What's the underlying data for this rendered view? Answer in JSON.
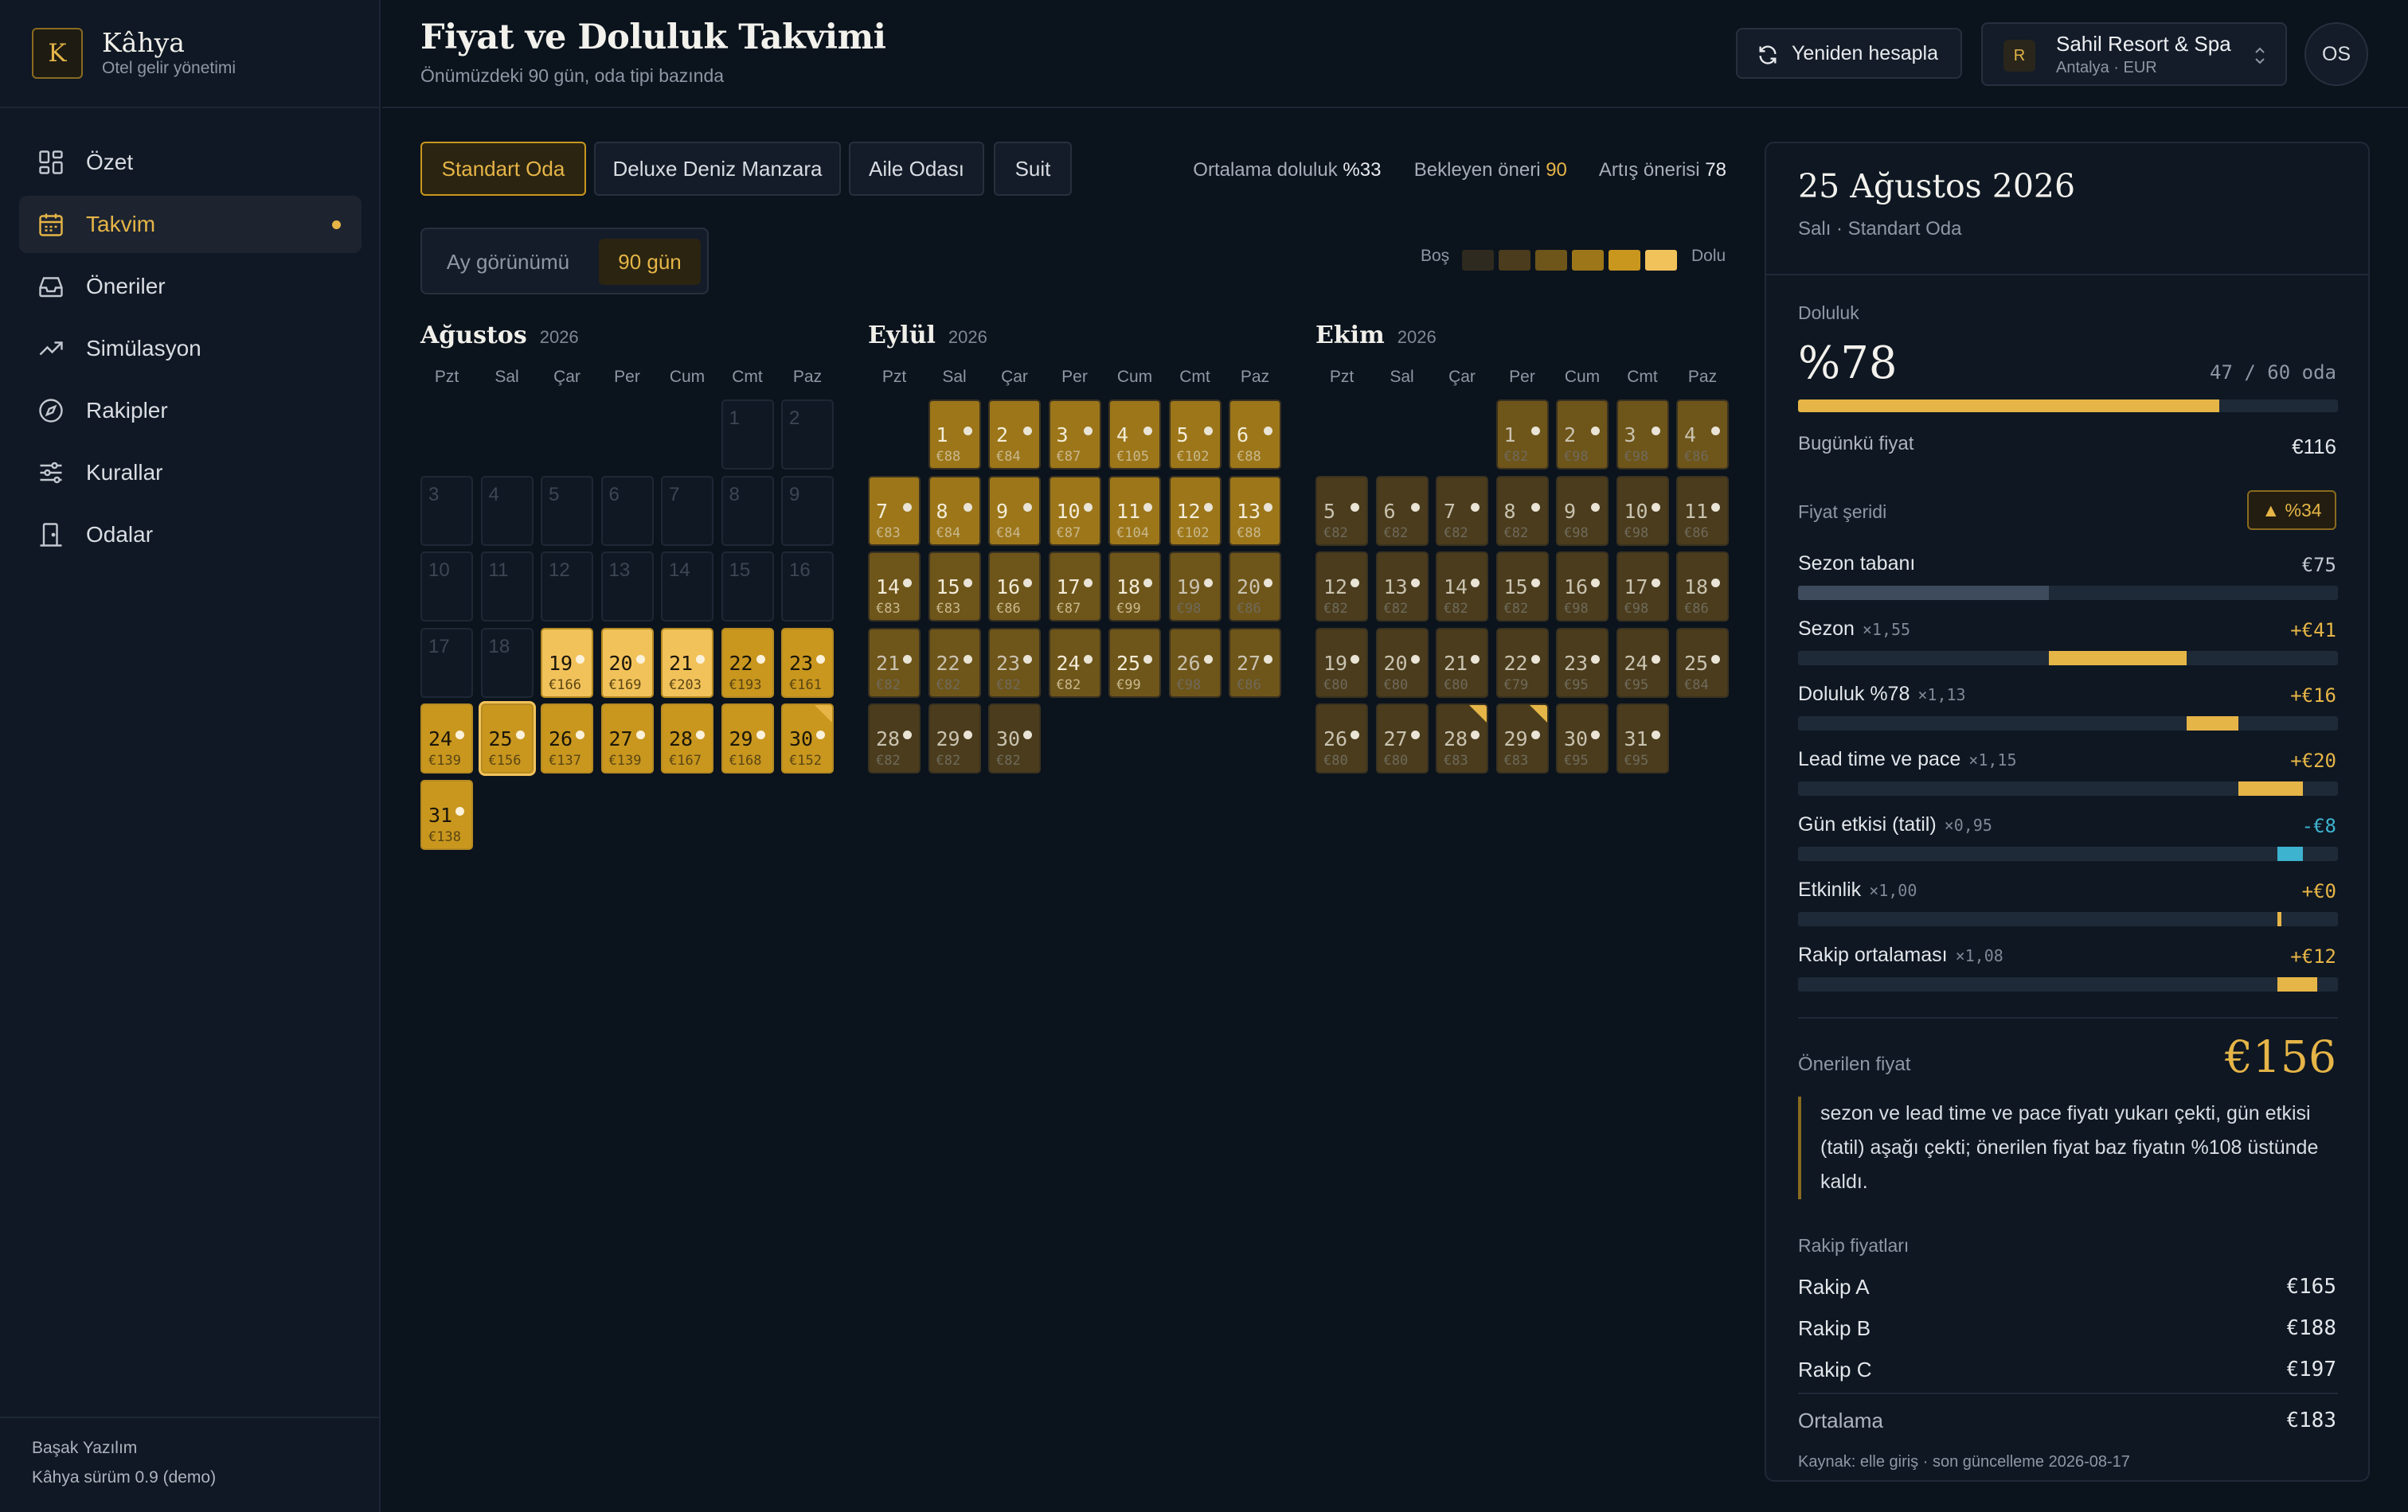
{
  "app": {
    "logo_letter": "K",
    "name": "Kâhya",
    "subtitle": "Otel gelir yönetimi"
  },
  "nav": [
    {
      "label": "Özet",
      "icon": "dashboard-icon"
    },
    {
      "label": "Takvim",
      "icon": "calendar-icon",
      "active": true
    },
    {
      "label": "Öneriler",
      "icon": "inbox-icon"
    },
    {
      "label": "Simülasyon",
      "icon": "trend-icon"
    },
    {
      "label": "Rakipler",
      "icon": "compass-icon"
    },
    {
      "label": "Kurallar",
      "icon": "sliders-icon"
    },
    {
      "label": "Odalar",
      "icon": "door-icon"
    }
  ],
  "footer": {
    "company": "Başak Yazılım",
    "version": "Kâhya sürüm 0.9 (demo)"
  },
  "header": {
    "title": "Fiyat ve Doluluk Takvimi",
    "subtitle": "Önümüzdeki 90 gün, oda tipi bazında",
    "recalc_label": "Yeniden hesapla",
    "hotel_badge": "R",
    "hotel_name": "Sahil Resort & Spa",
    "hotel_location": "Antalya · EUR",
    "avatar": "OS"
  },
  "room_tabs": [
    "Standart Oda",
    "Deluxe Deniz Manzara",
    "Aile Odası",
    "Suit"
  ],
  "stats": {
    "avg_label": "Ortalama doluluk",
    "avg_value": "%33",
    "pending_label": "Bekleyen öneri",
    "pending_value": "90",
    "raise_label": "Artış önerisi",
    "raise_value": "78"
  },
  "view_toggle": {
    "month": "Ay görünümü",
    "days90": "90 gün"
  },
  "legend": {
    "empty": "Boş",
    "full": "Dolu"
  },
  "weekdays": [
    "Pzt",
    "Sal",
    "Çar",
    "Per",
    "Cum",
    "Cmt",
    "Paz"
  ],
  "colors": {
    "accent": "#e6b547",
    "occupancy_scale": [
      "#2f2a1f",
      "#4a3c1c",
      "#6e5519",
      "#9c7619",
      "#c9971e",
      "#f2c25a"
    ]
  },
  "months": [
    {
      "name": "Ağustos",
      "year": "2026",
      "offset": 5,
      "days": [
        {
          "d": 1,
          "past": true
        },
        {
          "d": 2,
          "past": true
        },
        {
          "d": 3,
          "past": true
        },
        {
          "d": 4,
          "past": true
        },
        {
          "d": 5,
          "past": true
        },
        {
          "d": 6,
          "past": true
        },
        {
          "d": 7,
          "past": true
        },
        {
          "d": 8,
          "past": true
        },
        {
          "d": 9,
          "past": true
        },
        {
          "d": 10,
          "past": true
        },
        {
          "d": 11,
          "past": true
        },
        {
          "d": 12,
          "past": true
        },
        {
          "d": 13,
          "past": true
        },
        {
          "d": 14,
          "past": true
        },
        {
          "d": 15,
          "past": true
        },
        {
          "d": 16,
          "past": true
        },
        {
          "d": 17,
          "past": true
        },
        {
          "d": 18,
          "past": true
        },
        {
          "d": 19,
          "p": "€166",
          "o": 0.95
        },
        {
          "d": 20,
          "p": "€169",
          "o": 0.95
        },
        {
          "d": 21,
          "p": "€203",
          "o": 0.95
        },
        {
          "d": 22,
          "p": "€193",
          "o": 0.8
        },
        {
          "d": 23,
          "p": "€161",
          "o": 0.8
        },
        {
          "d": 24,
          "p": "€139",
          "o": 0.7
        },
        {
          "d": 25,
          "p": "€156",
          "o": 0.78,
          "sel": true
        },
        {
          "d": 26,
          "p": "€137",
          "o": 0.7
        },
        {
          "d": 27,
          "p": "€139",
          "o": 0.7
        },
        {
          "d": 28,
          "p": "€167",
          "o": 0.7
        },
        {
          "d": 29,
          "p": "€168",
          "o": 0.7
        },
        {
          "d": 30,
          "p": "€152",
          "o": 0.7,
          "flag": true
        },
        {
          "d": 31,
          "p": "€138",
          "o": 0.7
        }
      ]
    },
    {
      "name": "Eylül",
      "year": "2026",
      "offset": 1,
      "days": [
        {
          "d": 1,
          "p": "€88",
          "o": 0.5
        },
        {
          "d": 2,
          "p": "€84",
          "o": 0.5
        },
        {
          "d": 3,
          "p": "€87",
          "o": 0.5
        },
        {
          "d": 4,
          "p": "€105",
          "o": 0.5
        },
        {
          "d": 5,
          "p": "€102",
          "o": 0.5
        },
        {
          "d": 6,
          "p": "€88",
          "o": 0.5
        },
        {
          "d": 7,
          "p": "€83",
          "o": 0.5
        },
        {
          "d": 8,
          "p": "€84",
          "o": 0.5
        },
        {
          "d": 9,
          "p": "€84",
          "o": 0.5
        },
        {
          "d": 10,
          "p": "€87",
          "o": 0.5
        },
        {
          "d": 11,
          "p": "€104",
          "o": 0.5
        },
        {
          "d": 12,
          "p": "€102",
          "o": 0.5
        },
        {
          "d": 13,
          "p": "€88",
          "o": 0.5
        },
        {
          "d": 14,
          "p": "€83",
          "o": 0.4
        },
        {
          "d": 15,
          "p": "€83",
          "o": 0.4
        },
        {
          "d": 16,
          "p": "€86",
          "o": 0.4
        },
        {
          "d": 17,
          "p": "€87",
          "o": 0.4
        },
        {
          "d": 18,
          "p": "€99",
          "o": 0.4
        },
        {
          "d": 19,
          "p": "€98",
          "o": 0.3
        },
        {
          "d": 20,
          "p": "€86",
          "o": 0.3
        },
        {
          "d": 21,
          "p": "€82",
          "o": 0.3
        },
        {
          "d": 22,
          "p": "€82",
          "o": 0.3
        },
        {
          "d": 23,
          "p": "€82",
          "o": 0.3
        },
        {
          "d": 24,
          "p": "€82",
          "o": 0.4
        },
        {
          "d": 25,
          "p": "€99",
          "o": 0.4
        },
        {
          "d": 26,
          "p": "€98",
          "o": 0.3
        },
        {
          "d": 27,
          "p": "€86",
          "o": 0.3
        },
        {
          "d": 28,
          "p": "€82",
          "o": 0.2
        },
        {
          "d": 29,
          "p": "€82",
          "o": 0.2
        },
        {
          "d": 30,
          "p": "€82",
          "o": 0.2
        }
      ]
    },
    {
      "name": "Ekim",
      "year": "2026",
      "offset": 3,
      "days": [
        {
          "d": 1,
          "p": "€82",
          "o": 0.3
        },
        {
          "d": 2,
          "p": "€98",
          "o": 0.3
        },
        {
          "d": 3,
          "p": "€98",
          "o": 0.3
        },
        {
          "d": 4,
          "p": "€86",
          "o": 0.3
        },
        {
          "d": 5,
          "p": "€82",
          "o": 0.1
        },
        {
          "d": 6,
          "p": "€82",
          "o": 0.1
        },
        {
          "d": 7,
          "p": "€82",
          "o": 0.1
        },
        {
          "d": 8,
          "p": "€82",
          "o": 0.2
        },
        {
          "d": 9,
          "p": "€98",
          "o": 0.2
        },
        {
          "d": 10,
          "p": "€98",
          "o": 0.2
        },
        {
          "d": 11,
          "p": "€86",
          "o": 0.2
        },
        {
          "d": 12,
          "p": "€82",
          "o": 0.1
        },
        {
          "d": 13,
          "p": "€82",
          "o": 0.1
        },
        {
          "d": 14,
          "p": "€82",
          "o": 0.1
        },
        {
          "d": 15,
          "p": "€82",
          "o": 0.2
        },
        {
          "d": 16,
          "p": "€98",
          "o": 0.2
        },
        {
          "d": 17,
          "p": "€98",
          "o": 0.2
        },
        {
          "d": 18,
          "p": "€86",
          "o": 0.2
        },
        {
          "d": 19,
          "p": "€80",
          "o": 0.1
        },
        {
          "d": 20,
          "p": "€80",
          "o": 0.1
        },
        {
          "d": 21,
          "p": "€80",
          "o": 0.1
        },
        {
          "d": 22,
          "p": "€79",
          "o": 0.1
        },
        {
          "d": 23,
          "p": "€95",
          "o": 0.1
        },
        {
          "d": 24,
          "p": "€95",
          "o": 0.1
        },
        {
          "d": 25,
          "p": "€84",
          "o": 0.1
        },
        {
          "d": 26,
          "p": "€80",
          "o": 0.1
        },
        {
          "d": 27,
          "p": "€80",
          "o": 0.1
        },
        {
          "d": 28,
          "p": "€83",
          "o": 0.1,
          "flag": true
        },
        {
          "d": 29,
          "p": "€83",
          "o": 0.1,
          "flag": true
        },
        {
          "d": 30,
          "p": "€95",
          "o": 0.1
        },
        {
          "d": 31,
          "p": "€95",
          "o": 0.1
        }
      ]
    }
  ],
  "panel": {
    "date": "25 Ağustos 2026",
    "sub": "Salı · Standart Oda",
    "occ_label": "Doluluk",
    "occ_value": "%78",
    "occ_fraction": 0.78,
    "rooms": "47 / 60 oda",
    "today_label": "Bugünkü fiyat",
    "today_value": "€116",
    "band_label": "Fiyat şeridi",
    "band_badge": "▲ %34",
    "factors": [
      {
        "label": "Sezon tabanı",
        "mult": "",
        "value": "€75",
        "kind": "base",
        "start": 0.0,
        "end": 0.465
      },
      {
        "label": "Sezon",
        "mult": "×1,55",
        "value": "+€41",
        "kind": "up",
        "start": 0.465,
        "end": 0.72
      },
      {
        "label": "Doluluk %78",
        "mult": "×1,13",
        "value": "+€16",
        "kind": "up",
        "start": 0.72,
        "end": 0.815
      },
      {
        "label": "Lead time ve pace",
        "mult": "×1,15",
        "value": "+€20",
        "kind": "up",
        "start": 0.815,
        "end": 0.935
      },
      {
        "label": "Gün etkisi (tatil)",
        "mult": "×0,95",
        "value": "-€8",
        "kind": "down",
        "start": 0.888,
        "end": 0.935
      },
      {
        "label": "Etkinlik",
        "mult": "×1,00",
        "value": "+€0",
        "kind": "up",
        "start": 0.888,
        "end": 0.895
      },
      {
        "label": "Rakip ortalaması",
        "mult": "×1,08",
        "value": "+€12",
        "kind": "up",
        "start": 0.888,
        "end": 0.962
      }
    ],
    "rec_label": "Önerilen fiyat",
    "rec_value": "€156",
    "explanation": "sezon ve lead time ve pace fiyatı yukarı çekti, gün etkisi (tatil) aşağı çekti; önerilen fiyat baz fiyatın %108 üstünde kaldı.",
    "comp_title": "Rakip fiyatları",
    "competitors": [
      {
        "name": "Rakip A",
        "price": "€165"
      },
      {
        "name": "Rakip B",
        "price": "€188"
      },
      {
        "name": "Rakip C",
        "price": "€197"
      }
    ],
    "avg_label": "Ortalama",
    "avg_value": "€183",
    "source": "Kaynak: elle giriş · son güncelleme 2026-08-17"
  }
}
